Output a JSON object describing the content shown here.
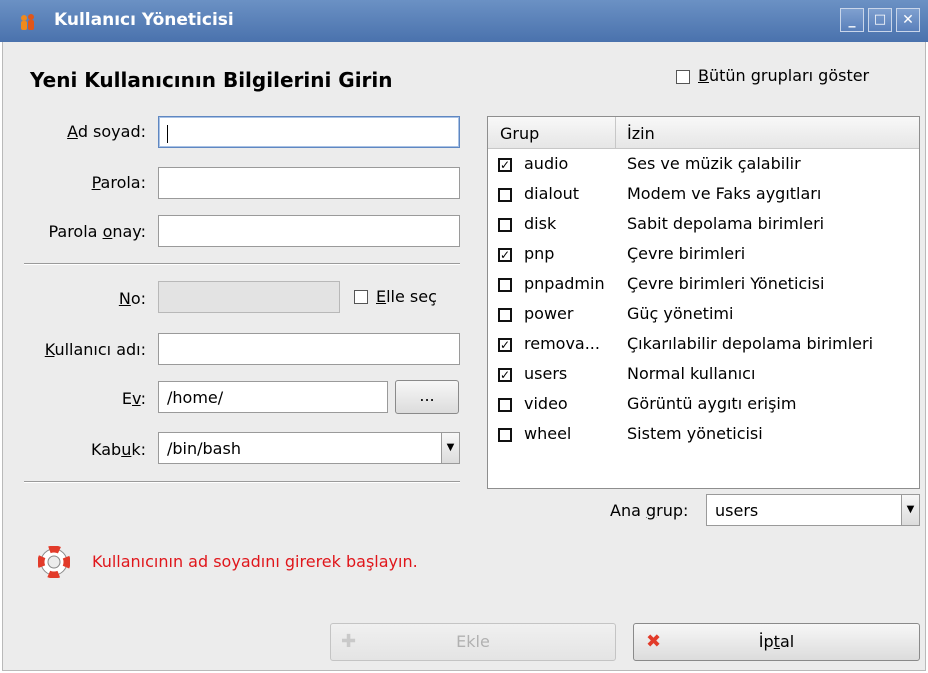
{
  "window": {
    "title": "Kullanıcı Yöneticisi",
    "controls": {
      "minimize": "_",
      "maximize": "□",
      "close": "✕"
    }
  },
  "form": {
    "heading": "Yeni Kullanıcının Bilgilerini Girin",
    "show_all_groups": {
      "label": "Bütün grupları göster",
      "accesskey": "B",
      "rest": "ütün grupları göster",
      "checked": false
    },
    "fullname": {
      "label_access": "A",
      "label_rest": "d soyad:",
      "value": ""
    },
    "password": {
      "label_access": "P",
      "label_rest": "arola:",
      "value": ""
    },
    "password_confirm": {
      "label_pre": "Parola ",
      "label_access": "o",
      "label_rest": "nay:",
      "value": ""
    },
    "uid": {
      "label_access": "N",
      "label_rest": "o:",
      "value": "",
      "manual_pick": {
        "access": "E",
        "rest": "lle seç",
        "checked": false
      }
    },
    "username": {
      "label_access": "K",
      "label_rest": "ullanıcı adı:",
      "value": ""
    },
    "home": {
      "label_pre": "E",
      "label_access": "v",
      "label_rest": ":",
      "value": "/home/",
      "browse_label": "..."
    },
    "shell": {
      "label_pre": "Kab",
      "label_access": "u",
      "label_rest": "k:",
      "value": "/bin/bash"
    }
  },
  "groups": {
    "columns": [
      "Grup",
      "İzin"
    ],
    "rows": [
      {
        "name": "audio",
        "permission": "Ses ve müzik çalabilir",
        "checked": true
      },
      {
        "name": "dialout",
        "permission": "Modem ve Faks aygıtları",
        "checked": false
      },
      {
        "name": "disk",
        "permission": "Sabit depolama birimleri",
        "checked": false
      },
      {
        "name": "pnp",
        "permission": "Çevre birimleri",
        "checked": true
      },
      {
        "name": "pnpadmin",
        "permission": "Çevre birimleri Yöneticisi",
        "checked": false
      },
      {
        "name": "power",
        "permission": "Güç yönetimi",
        "checked": false
      },
      {
        "name": "remova...",
        "permission": "Çıkarılabilir depolama birimleri",
        "checked": true
      },
      {
        "name": "users",
        "permission": "Normal kullanıcı",
        "checked": true
      },
      {
        "name": "video",
        "permission": "Görüntü aygıtı erişim",
        "checked": false
      },
      {
        "name": "wheel",
        "permission": "Sistem yöneticisi",
        "checked": false
      }
    ],
    "main_group": {
      "label_pre": "Ana ",
      "label_access": "g",
      "label_rest": "rup:",
      "value": "users"
    }
  },
  "status": {
    "message": "Kullanıcının ad soyadını girerek başlayın.",
    "icon": "lifebuoy-icon"
  },
  "buttons": {
    "add": {
      "label": "Ekle",
      "enabled": false
    },
    "cancel": {
      "label_pre": "İp",
      "label_access": "t",
      "label_rest": "al"
    }
  },
  "colors": {
    "titlebar": "#5a80bb",
    "error_text": "#e0161b",
    "dialog_bg": "#ececec"
  }
}
